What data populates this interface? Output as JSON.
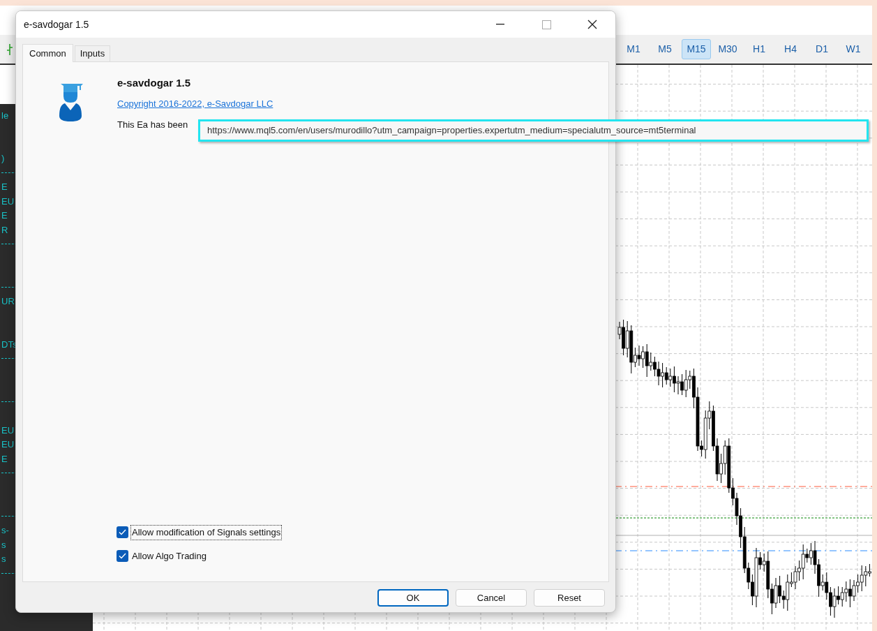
{
  "app": {
    "timeframes": [
      {
        "label": "M1",
        "selected": false
      },
      {
        "label": "M5",
        "selected": false
      },
      {
        "label": "M15",
        "selected": true
      },
      {
        "label": "M30",
        "selected": false
      },
      {
        "label": "H1",
        "selected": false
      },
      {
        "label": "H4",
        "selected": false
      },
      {
        "label": "D1",
        "selected": false
      },
      {
        "label": "W1",
        "selected": false
      }
    ],
    "side_panel": {
      "rows": [
        {
          "kind": "text",
          "text": "le"
        },
        {
          "kind": "blank"
        },
        {
          "kind": "blank"
        },
        {
          "kind": "text",
          "text": ")"
        },
        {
          "kind": "rule"
        },
        {
          "kind": "text",
          "text": "E"
        },
        {
          "kind": "text",
          "text": "EU"
        },
        {
          "kind": "text",
          "text": "E"
        },
        {
          "kind": "text",
          "text": "R"
        },
        {
          "kind": "rule"
        },
        {
          "kind": "blank"
        },
        {
          "kind": "blank"
        },
        {
          "kind": "rule"
        },
        {
          "kind": "text",
          "text": "UR"
        },
        {
          "kind": "blank"
        },
        {
          "kind": "blank"
        },
        {
          "kind": "text",
          "text": "DTs"
        },
        {
          "kind": "rule"
        },
        {
          "kind": "blank"
        },
        {
          "kind": "blank"
        },
        {
          "kind": "rule"
        },
        {
          "kind": "blank"
        },
        {
          "kind": "text",
          "text": "EU"
        },
        {
          "kind": "text",
          "text": "EU"
        },
        {
          "kind": "text",
          "text": "E"
        },
        {
          "kind": "rule"
        },
        {
          "kind": "blank"
        },
        {
          "kind": "blank"
        },
        {
          "kind": "rule"
        },
        {
          "kind": "text",
          "text": "s-"
        },
        {
          "kind": "text",
          "text": "s"
        },
        {
          "kind": "text",
          "text": "s"
        },
        {
          "kind": "rule"
        }
      ]
    }
  },
  "dialog": {
    "title": "e-savdogar 1.5",
    "tabs": [
      {
        "label": "Common",
        "selected": true
      },
      {
        "label": "Inputs",
        "selected": false
      }
    ],
    "expert": {
      "name": "e-savdogar 1.5",
      "copyright_link": "Copyright 2016-2022, e-Savdogar LLC",
      "description": "This Ea has been"
    },
    "tooltip": "https://www.mql5.com/en/users/murodillo?utm_campaign=properties.expertutm_medium=specialutm_source=mt5terminal",
    "options": [
      {
        "label": "Allow modification of Signals settings",
        "checked": true,
        "focused": true
      },
      {
        "label": "Allow Algo Trading",
        "checked": true,
        "focused": false
      }
    ],
    "buttons": [
      {
        "label": "OK",
        "default": true
      },
      {
        "label": "Cancel",
        "default": false
      },
      {
        "label": "Reset",
        "default": false
      }
    ]
  }
}
